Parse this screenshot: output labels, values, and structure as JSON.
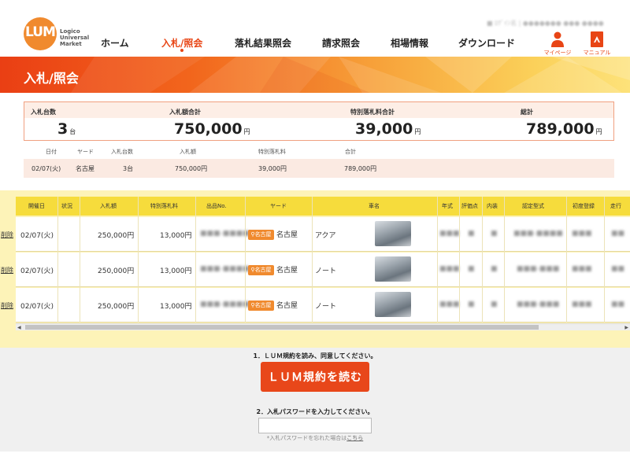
{
  "logo": {
    "mark": "LUM",
    "line1": "Logico",
    "line2": "Universal",
    "line3": "Market"
  },
  "user_info": "■ ﾛｸﾞｲﾝ名 | ●●●●●●● ●●● ●●●●",
  "nav": {
    "items": [
      {
        "label": "ホーム"
      },
      {
        "label": "入札/照会"
      },
      {
        "label": "落札結果照会"
      },
      {
        "label": "請求照会"
      },
      {
        "label": "相場情報"
      },
      {
        "label": "ダウンロード"
      }
    ],
    "active_index": 1
  },
  "header_buttons": {
    "mypage": "マイページ",
    "manual": "マニュアル"
  },
  "banner": {
    "title": "入札/照会"
  },
  "summary": {
    "labels": {
      "count": "入札台数",
      "bid_total": "入札額合計",
      "special_total": "特別落札料合計",
      "grand_total": "総計"
    },
    "values": {
      "count": "3",
      "bid_total": "750,000",
      "special_total": "39,000",
      "grand_total": "789,000"
    },
    "units": {
      "count": "台",
      "yen": "円"
    }
  },
  "detail": {
    "headers": [
      "日付",
      "ヤード",
      "入札台数",
      "入札額",
      "特別落札料",
      "合計"
    ],
    "row": [
      "02/07(火)",
      "名古屋",
      "3台",
      "750,000円",
      "39,000円",
      "789,000円"
    ]
  },
  "table": {
    "headers": [
      "開催日",
      "状況",
      "入札額",
      "特別落札料",
      "出品No.",
      "ヤード",
      "車名",
      "年式",
      "評価点",
      "内装",
      "認定型式",
      "初度登録",
      "走行"
    ],
    "delete_label": "削除",
    "rows": [
      {
        "date": "02/07(火)",
        "status": "",
        "bid": "250,000円",
        "fee": "13,000円",
        "lot": "■■■-■■■■",
        "yard_badge": "名古屋",
        "yard": "名古屋",
        "car": "アクア",
        "year": "■■■",
        "score": "■",
        "interior": "■",
        "model": "■■■-■■■■",
        "first_reg": "■■■",
        "mileage": "■■"
      },
      {
        "date": "02/07(火)",
        "status": "",
        "bid": "250,000円",
        "fee": "13,000円",
        "lot": "■■■-■■■■",
        "yard_badge": "名古屋",
        "yard": "名古屋",
        "car": "ノート",
        "year": "■■■",
        "score": "■",
        "interior": "■",
        "model": "■■■-■■■",
        "first_reg": "■■■",
        "mileage": "■■"
      },
      {
        "date": "02/07(火)",
        "status": "",
        "bid": "250,000円",
        "fee": "13,000円",
        "lot": "■■■-■■■■",
        "yard_badge": "名古屋",
        "yard": "名古屋",
        "car": "ノート",
        "year": "■■■",
        "score": "■",
        "interior": "■",
        "model": "■■■-■■■",
        "first_reg": "■■■",
        "mileage": "■■"
      }
    ]
  },
  "terms": {
    "step1": "1．ＬＵＭ規約を読み、同意してください。",
    "read_button": "ＬＵＭ規約を読む",
    "step2": "2．入札パスワードを入力してください。",
    "password_value": "",
    "forgot_prefix": "*入札パスワードを忘れた場合は",
    "forgot_link": "こちら"
  },
  "colors": {
    "accent": "#e84515",
    "brand_orange": "#f08a2e",
    "table_header": "#f6dc3c",
    "table_bg": "#fdf3b8"
  }
}
